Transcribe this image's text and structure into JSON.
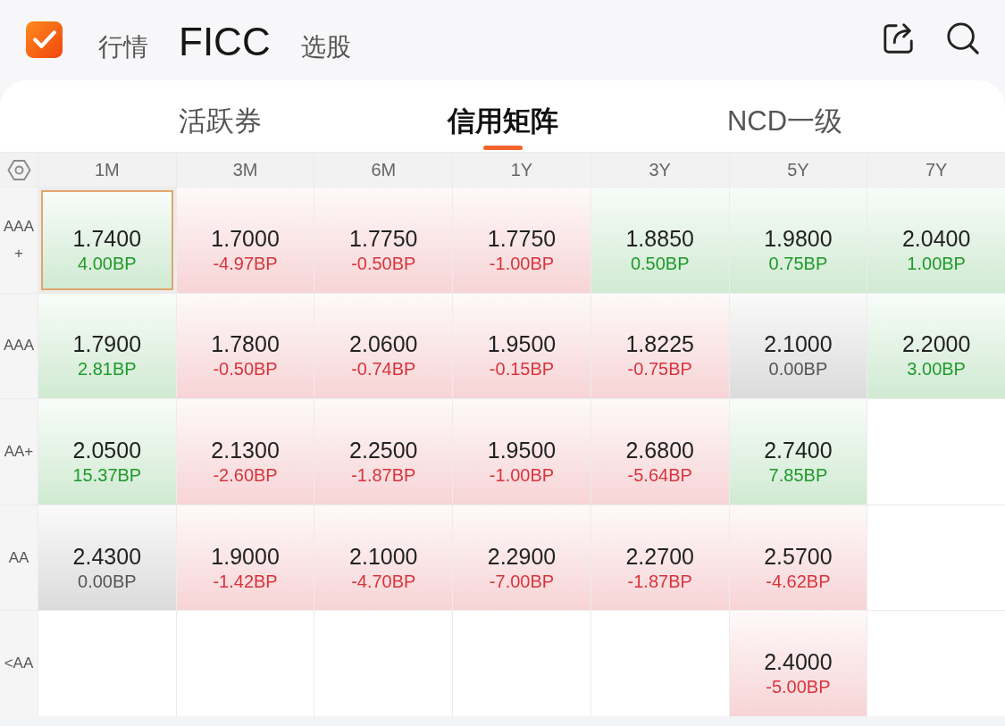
{
  "top_nav": [
    {
      "label": "行情",
      "selected": false
    },
    {
      "label": "FICC",
      "selected": true
    },
    {
      "label": "选股",
      "selected": false
    }
  ],
  "sub_tabs": [
    {
      "label": "活跃券",
      "selected": false
    },
    {
      "label": "信用矩阵",
      "selected": true
    },
    {
      "label": "NCD一级",
      "selected": false
    }
  ],
  "matrix": {
    "columns": [
      "1M",
      "3M",
      "6M",
      "1Y",
      "3Y",
      "5Y",
      "7Y"
    ],
    "rows": [
      {
        "label": "AAA+",
        "cells": [
          {
            "value": "1.7400",
            "change": "4.00BP",
            "color": "#1f9a2a",
            "selected": true
          },
          {
            "value": "1.7000",
            "change": "-4.97BP",
            "color": "#d8343c",
            "selected": false
          },
          {
            "value": "1.7750",
            "change": "-0.50BP",
            "color": "#d8343c",
            "selected": false
          },
          {
            "value": "1.7750",
            "change": "-1.00BP",
            "color": "#d8343c",
            "selected": false
          },
          {
            "value": "1.8850",
            "change": "0.50BP",
            "color": "#1f9a2a",
            "selected": false
          },
          {
            "value": "1.9800",
            "change": "0.75BP",
            "color": "#1f9a2a",
            "selected": false
          },
          {
            "value": "2.0400",
            "change": "1.00BP",
            "color": "#1f9a2a",
            "selected": false
          }
        ]
      },
      {
        "label": "AAA",
        "cells": [
          {
            "value": "1.7900",
            "change": "2.81BP",
            "color": "#1f9a2a",
            "selected": false
          },
          {
            "value": "1.7800",
            "change": "-0.50BP",
            "color": "#d8343c",
            "selected": false
          },
          {
            "value": "2.0600",
            "change": "-0.74BP",
            "color": "#d8343c",
            "selected": false
          },
          {
            "value": "1.9500",
            "change": "-0.15BP",
            "color": "#d8343c",
            "selected": false
          },
          {
            "value": "1.8225",
            "change": "-0.75BP",
            "color": "#d8343c",
            "selected": false
          },
          {
            "value": "2.1000",
            "change": "0.00BP",
            "color": "#555555",
            "selected": false
          },
          {
            "value": "2.2000",
            "change": "3.00BP",
            "color": "#1f9a2a",
            "selected": false
          }
        ]
      },
      {
        "label": "AA+",
        "cells": [
          {
            "value": "2.0500",
            "change": "15.37BP",
            "color": "#1f9a2a",
            "selected": false
          },
          {
            "value": "2.1300",
            "change": "-2.60BP",
            "color": "#d8343c",
            "selected": false
          },
          {
            "value": "2.2500",
            "change": "-1.87BP",
            "color": "#d8343c",
            "selected": false
          },
          {
            "value": "1.9500",
            "change": "-1.00BP",
            "color": "#d8343c",
            "selected": false
          },
          {
            "value": "2.6800",
            "change": "-5.64BP",
            "color": "#d8343c",
            "selected": false
          },
          {
            "value": "2.7400",
            "change": "7.85BP",
            "color": "#1f9a2a",
            "selected": false
          },
          null
        ]
      },
      {
        "label": "AA",
        "cells": [
          {
            "value": "2.4300",
            "change": "0.00BP",
            "color": "#555555",
            "selected": false
          },
          {
            "value": "1.9000",
            "change": "-1.42BP",
            "color": "#d8343c",
            "selected": false
          },
          {
            "value": "2.1000",
            "change": "-4.70BP",
            "color": "#d8343c",
            "selected": false
          },
          {
            "value": "2.2900",
            "change": "-7.00BP",
            "color": "#d8343c",
            "selected": false
          },
          {
            "value": "2.2700",
            "change": "-1.87BP",
            "color": "#d8343c",
            "selected": false
          },
          {
            "value": "2.5700",
            "change": "-4.62BP",
            "color": "#d8343c",
            "selected": false
          },
          null
        ]
      },
      {
        "label": "<AA",
        "cells": [
          null,
          null,
          null,
          null,
          null,
          {
            "value": "2.4000",
            "change": "-5.00BP",
            "color": "#d8343c",
            "selected": false
          },
          null
        ]
      }
    ]
  }
}
